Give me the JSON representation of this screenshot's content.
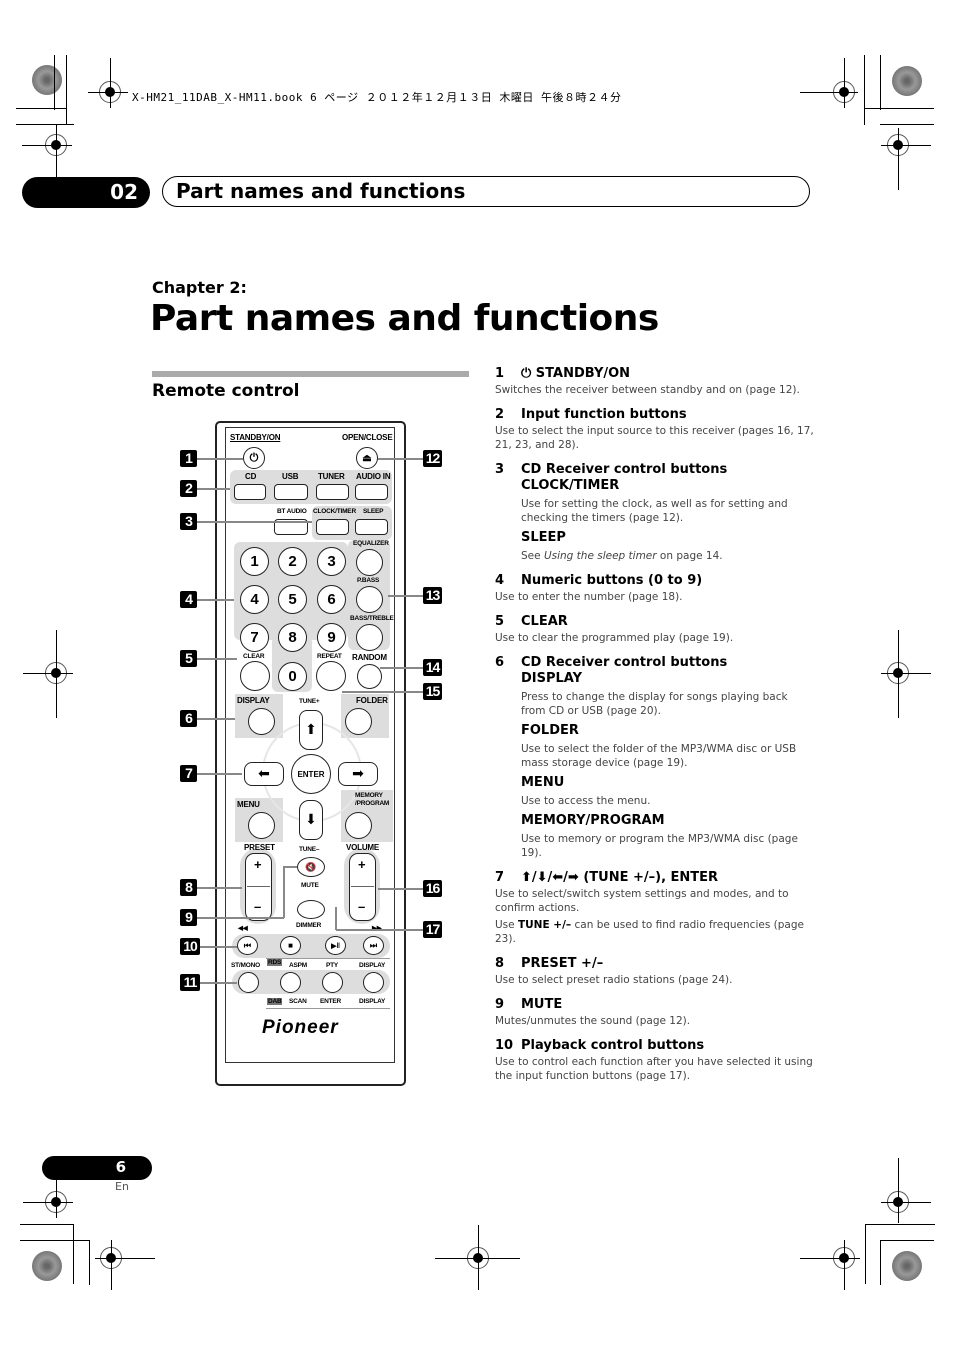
{
  "print_header": "X-HM21_11DAB_X-HM11.book  6 ページ  ２０１２年１２月１３日  木曜日  午後８時２４分",
  "chapter_tab": {
    "number": "02",
    "title": "Part names and functions"
  },
  "chapter_label": "Chapter 2:",
  "page_title": "Part names and functions",
  "section_title": "Remote control",
  "remote": {
    "labels": {
      "standby": "STANDBY/ON",
      "open_close": "OPEN/CLOSE",
      "cd": "CD",
      "usb": "USB",
      "tuner": "TUNER",
      "audio_in": "AUDIO IN",
      "bt_audio": "BT AUDIO",
      "clock_timer": "CLOCK/TIMER",
      "sleep": "SLEEP",
      "equalizer": "EQUALIZER",
      "pbass": "P.BASS",
      "bass_treble": "BASS/TREBLE",
      "clear": "CLEAR",
      "repeat": "REPEAT",
      "random": "RANDOM",
      "display": "DISPLAY",
      "tune_plus": "TUNE+",
      "folder": "FOLDER",
      "enter": "ENTER",
      "menu": "MENU",
      "memory_program": "MEMORY\n/PROGRAM",
      "preset": "PRESET",
      "tune_minus": "TUNE–",
      "volume": "VOLUME",
      "mute": "MUTE",
      "dimmer": "DIMMER",
      "st_mono": "ST/MONO",
      "rds": "RDS",
      "aspm": "ASPM",
      "pty": "PTY",
      "display2": "DISPLAY",
      "dab": "DAB",
      "scan": "SCAN",
      "enter2": "ENTER",
      "display3": "DISPLAY",
      "plus": "+",
      "minus": "–"
    },
    "digits": [
      "1",
      "2",
      "3",
      "4",
      "5",
      "6",
      "7",
      "8",
      "9",
      "0"
    ],
    "brand": "Pioneer",
    "callouts": [
      "1",
      "2",
      "3",
      "4",
      "5",
      "6",
      "7",
      "8",
      "9",
      "10",
      "11",
      "12",
      "13",
      "14",
      "15",
      "16",
      "17"
    ]
  },
  "items": [
    {
      "num": "1",
      "title": "⏻ STANDBY/ON",
      "text": "Switches the receiver between standby and on (page 12)."
    },
    {
      "num": "2",
      "title": "Input function buttons",
      "text": "Use to select the input source to this receiver (pages 16, 17, 21, 23, and 28)."
    },
    {
      "num": "3",
      "title": "CD Receiver control buttons",
      "subs": [
        {
          "title": "CLOCK/TIMER",
          "text": "Use for setting the clock, as well as for setting and checking the timers (page 12)."
        },
        {
          "title": "SLEEP",
          "text_pre": "See ",
          "text_em": "Using the sleep timer",
          "text_post": " on page 14."
        }
      ]
    },
    {
      "num": "4",
      "title": "Numeric buttons (0 to 9)",
      "text": "Use to enter the number (page 18)."
    },
    {
      "num": "5",
      "title": "CLEAR",
      "text": "Use to clear the programmed play (page 19)."
    },
    {
      "num": "6",
      "title": "CD Receiver control buttons",
      "subs": [
        {
          "title": "DISPLAY",
          "text": "Press to change the display for songs playing back from CD or USB (page 20)."
        },
        {
          "title": "FOLDER",
          "text": "Use to select the folder of the MP3/WMA disc or USB mass storage device (page 19)."
        },
        {
          "title": "MENU",
          "text": "Use to access the menu."
        },
        {
          "title": "MEMORY/PROGRAM",
          "text": "Use to memory or program the MP3/WMA disc (page 19)."
        }
      ]
    },
    {
      "num": "7",
      "title": "⬆/⬇/⬅/➡ (TUNE +/–), ENTER",
      "text": "Use to select/switch system settings and modes, and to confirm actions.",
      "text2_pre": "Use ",
      "text2_b": "TUNE +/–",
      "text2_post": " can be used to find radio frequencies (page 23)."
    },
    {
      "num": "8",
      "title": "PRESET +/–",
      "text": "Use to select preset radio stations (page 24)."
    },
    {
      "num": "9",
      "title": "MUTE",
      "text": "Mutes/unmutes the sound (page 12)."
    },
    {
      "num": "10",
      "title": "Playback control buttons",
      "text": "Use to control each function after you have selected it using the input function buttons (page 17)."
    }
  ],
  "folio": {
    "page": "6",
    "lang": "En"
  }
}
